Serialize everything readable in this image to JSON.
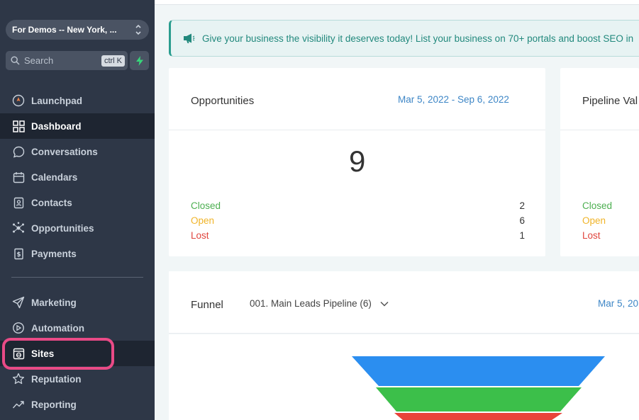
{
  "sidebar": {
    "account": "For Demos -- New York, ...",
    "search_placeholder": "Search",
    "search_shortcut": "ctrl K",
    "items": [
      {
        "label": "Launchpad",
        "icon": "rocket-icon"
      },
      {
        "label": "Dashboard",
        "icon": "grid-icon",
        "active": true
      },
      {
        "label": "Conversations",
        "icon": "chat-icon"
      },
      {
        "label": "Calendars",
        "icon": "calendar-icon"
      },
      {
        "label": "Contacts",
        "icon": "contacts-icon"
      },
      {
        "label": "Opportunities",
        "icon": "opportunities-icon"
      },
      {
        "label": "Payments",
        "icon": "payments-icon"
      },
      {
        "label": "Marketing",
        "icon": "send-icon"
      },
      {
        "label": "Automation",
        "icon": "automation-icon"
      },
      {
        "label": "Sites",
        "icon": "sites-icon",
        "highlighted": true
      },
      {
        "label": "Reputation",
        "icon": "star-icon"
      },
      {
        "label": "Reporting",
        "icon": "trend-icon"
      }
    ]
  },
  "banner": {
    "text": "Give your business the visibility it deserves today! List your business on 70+ portals and boost SEO in"
  },
  "opportunities": {
    "title": "Opportunities",
    "date_range": "Mar 5, 2022 - Sep 6, 2022",
    "total": "9",
    "rows": [
      {
        "label": "Closed",
        "value": "2"
      },
      {
        "label": "Open",
        "value": "6"
      },
      {
        "label": "Lost",
        "value": "1"
      }
    ]
  },
  "pipeline_value": {
    "title": "Pipeline Val",
    "rows": [
      {
        "label": "Closed"
      },
      {
        "label": "Open"
      },
      {
        "label": "Lost"
      }
    ]
  },
  "funnel": {
    "title": "Funnel",
    "pipeline": "001. Main Leads Pipeline (6)",
    "date_range": "Mar 5, 20",
    "stage_colors": [
      "#2b8ef0",
      "#3cbf4a",
      "#e8433a"
    ]
  },
  "colors": {
    "sidebar_bg": "#2e3747",
    "accent_teal": "#2a9d8f",
    "highlight_pink": "#e94a86",
    "date_blue": "#3d86c6"
  }
}
